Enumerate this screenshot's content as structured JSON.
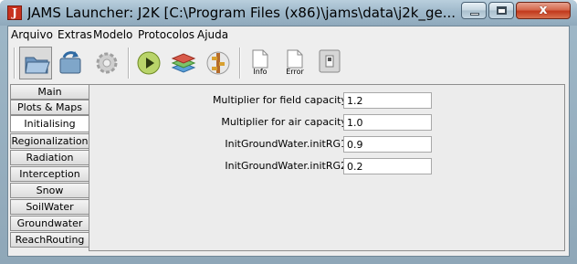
{
  "window": {
    "app_icon_letter": "J",
    "title": "JAMS Launcher: J2K [C:\\Program Files (x86)\\jams\\data\\j2k_ge...",
    "close_symbol": "x"
  },
  "menu": {
    "items": [
      "Arquivo",
      "Extras",
      "Modelo",
      "Protocolos",
      "Ajuda"
    ]
  },
  "toolbar": {
    "buttons": [
      {
        "icon": "open-folder-icon"
      },
      {
        "icon": "save-reload-icon"
      },
      {
        "icon": "gear-icon"
      },
      {
        "icon": "play-icon"
      },
      {
        "icon": "layers-map-icon"
      },
      {
        "icon": "model-tree-icon"
      }
    ],
    "info_label": "Info",
    "error_label": "Error",
    "extra_icon": "window-toggle-icon"
  },
  "tabs": [
    {
      "label": "Main",
      "active": false
    },
    {
      "label": "Plots & Maps",
      "active": false
    },
    {
      "label": "Initialising",
      "active": true
    },
    {
      "label": "Regionalization",
      "active": false
    },
    {
      "label": "Radiation",
      "active": false
    },
    {
      "label": "Interception",
      "active": false
    },
    {
      "label": "Snow",
      "active": false
    },
    {
      "label": "SoilWater",
      "active": false
    },
    {
      "label": "Groundwater",
      "active": false
    },
    {
      "label": "ReachRouting",
      "active": false
    }
  ],
  "parameters": [
    {
      "label": "Multiplier for field capacity",
      "value": "1.2"
    },
    {
      "label": "Multiplier for air capacity",
      "value": "1.0"
    },
    {
      "label": "InitGroundWater.initRG1",
      "value": "0.9"
    },
    {
      "label": "InitGroundWater.initRG2",
      "value": "0.2"
    }
  ]
}
